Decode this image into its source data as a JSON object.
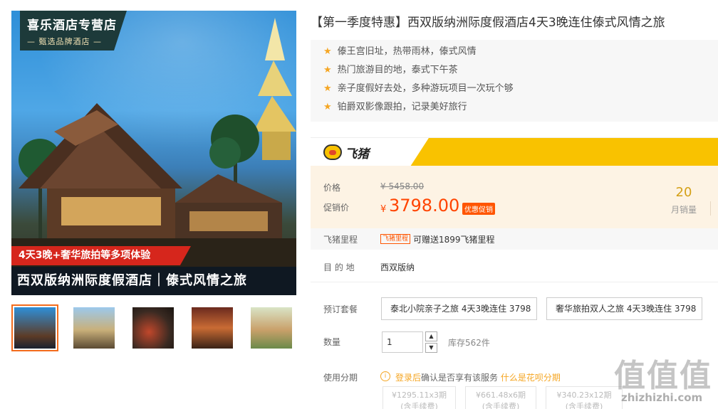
{
  "gallery": {
    "badge_title": "喜乐酒店专营店",
    "badge_subtitle": "— 甄选品牌酒店 —",
    "promo_text": "4天3晚+奢华旅拍等多项体验",
    "image_title": "西双版纳洲际度假酒店｜傣式风情之旅",
    "thumbnails": [
      "thumb-1",
      "thumb-2",
      "thumb-3",
      "thumb-4",
      "thumb-5"
    ]
  },
  "product": {
    "title": "【第一季度特惠】西双版纳洲际度假酒店4天3晚连住傣式风情之旅",
    "features": [
      "傣王宫旧址，热带雨林，傣式风情",
      "热门旅游目的地，泰式下午茶",
      "亲子度假好去处，多种游玩项目一次玩个够",
      "铂爵双影像跟拍，记录美好旅行"
    ]
  },
  "platform": {
    "name": "飞猪"
  },
  "price": {
    "price_label": "价格",
    "original": "¥ 5458.00",
    "promo_label": "促销价",
    "currency": "¥",
    "promo_value": "3798.00",
    "promo_tag": "优惠促销",
    "monthly_sales": "20",
    "monthly_sales_label": "月销量"
  },
  "miles": {
    "label": "飞猪里程",
    "tag": "飞猪里程",
    "text": "可赠送1899飞猪里程"
  },
  "destination": {
    "label": "目 的 地",
    "value": "西双版纳"
  },
  "packages": {
    "label": "预订套餐",
    "options": [
      "泰北小院亲子之旅 4天3晚连住 3798",
      "奢华旅拍双人之旅 4天3晚连住 3798"
    ]
  },
  "quantity": {
    "label": "数量",
    "value": "1",
    "up": "▲",
    "down": "▼",
    "stock": "库存562件"
  },
  "installment": {
    "label": "使用分期",
    "icon": "i",
    "login": "登录后",
    "middle": "确认是否享有该服务",
    "what": "什么是花呗分期",
    "options": [
      {
        "amount": "¥1295.11x3期",
        "fee": "(含手续费)"
      },
      {
        "amount": "¥661.48x6期",
        "fee": "(含手续费)"
      },
      {
        "amount": "¥340.23x12期",
        "fee": "(含手续费)"
      }
    ]
  },
  "watermark": {
    "glyphs": "值值值",
    "text": "zhizhizhi.com"
  }
}
